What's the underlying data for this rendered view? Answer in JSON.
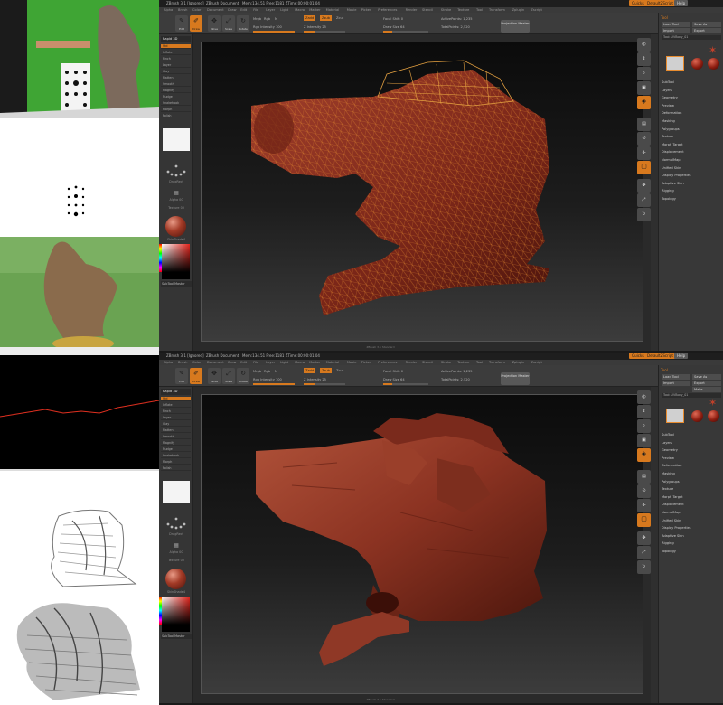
{
  "colors": {
    "orange": "#d7791e",
    "panel": "#383838",
    "mesh": "#8a2a1a",
    "wire": "#e39a2a"
  },
  "left_column": {
    "images": [
      {
        "name": "photo-person-with-statue"
      },
      {
        "name": "calibration-pattern"
      },
      {
        "name": "photo-bronze-statue"
      },
      {
        "name": "laser-scan-line"
      },
      {
        "name": "point-cloud-statue"
      },
      {
        "name": "point-cloud-statue-closeup"
      }
    ]
  },
  "windows": [
    {
      "id": "top",
      "title_main": "ZBrush 3.1 [Ignored]",
      "title_doc": "ZBrush Document",
      "title_stats": "Mem:134.51 Free:1181 ZTime:00:00:01.04",
      "quicksave": "Quicksave",
      "btn_help": "Help",
      "btn_defaultui": "DefaultZScript",
      "menus": [
        "Alpha",
        "Brush",
        "Color",
        "Document",
        "Draw",
        "Edit",
        "File",
        "Layer",
        "Light",
        "Macro",
        "Marker",
        "Material",
        "Movie",
        "Picker",
        "Preferences",
        "Render",
        "Stencil",
        "Stroke",
        "Texture",
        "Tool",
        "Transform",
        "Zplugin",
        "Zscript"
      ],
      "shelf": {
        "edit": "Edit",
        "draw": "Draw",
        "move": "Move",
        "scale": "Scale",
        "rotate": "Rotate",
        "mrgb": "Mrgb",
        "rgb": "Rgb",
        "m": "M",
        "zadd": "Zadd",
        "zsub": "Zsub",
        "zcut": "Zcut",
        "rgb_intensity": "Rgb Intensity 100",
        "z_intensity": "Z Intensity 25",
        "focal_shift": "Focal Shift 0",
        "draw_size": "Draw Size 64",
        "active_points": "ActivePoints: 1,235",
        "total_points": "TotalPoints: 2,520",
        "projection_master": "Projection Master"
      },
      "left_palette": {
        "rapid": "Rapid 3D",
        "items": [
          "Std",
          "Inflate",
          "Pinch",
          "Layer",
          "Clay",
          "Flatten",
          "Smooth",
          "Magnify",
          "Nudge",
          "Snakehook",
          "Morph",
          "Polish"
        ],
        "selected_index": 0,
        "stroke_label": "DragRect",
        "alpha_label": "Alpha 00",
        "texture_label": "Texture 00",
        "material_label": "SkinShade4",
        "subtool_label": "SubTool Master"
      },
      "right_panel": {
        "tool_header": "Tool",
        "load": "Load Tool",
        "save": "Save As",
        "import": "Import",
        "export": "Export",
        "make_poly": "Make PolyMesh3D",
        "tool_name": "Tool: UVBody_01",
        "menu_items": [
          "SubTool",
          "Layers",
          "Geometry",
          "Preview",
          "Deformation",
          "Masking",
          "Polygroups",
          "Texture",
          "Morph Target",
          "Displacement",
          "NormalMap",
          "Unified Skin",
          "Display Properties",
          "Adaptive Skin",
          "Rigging",
          "Topology"
        ],
        "show_make_poly": false
      },
      "viewport_caption": "ZBrush 3.1 Standard",
      "mesh_wire": true
    },
    {
      "id": "bottom",
      "title_main": "ZBrush 3.1 [Ignored]",
      "title_doc": "ZBrush Document",
      "title_stats": "Mem:134.51 Free:1181 ZTime:00:00:01.04",
      "quicksave": "Quicksave",
      "btn_help": "Help",
      "btn_defaultui": "DefaultZScript",
      "menus": [
        "Alpha",
        "Brush",
        "Color",
        "Document",
        "Draw",
        "Edit",
        "File",
        "Layer",
        "Light",
        "Macro",
        "Marker",
        "Material",
        "Movie",
        "Picker",
        "Preferences",
        "Render",
        "Stencil",
        "Stroke",
        "Texture",
        "Tool",
        "Transform",
        "Zplugin",
        "Zscript"
      ],
      "shelf": {
        "edit": "Edit",
        "draw": "Draw",
        "move": "Move",
        "scale": "Scale",
        "rotate": "Rotate",
        "mrgb": "Mrgb",
        "rgb": "Rgb",
        "m": "M",
        "zadd": "Zadd",
        "zsub": "Zsub",
        "zcut": "Zcut",
        "rgb_intensity": "Rgb Intensity 100",
        "z_intensity": "Z Intensity 25",
        "focal_shift": "Focal Shift 0",
        "draw_size": "Draw Size 64",
        "active_points": "ActivePoints: 1,235",
        "total_points": "TotalPoints: 2,520",
        "projection_master": "Projection Master"
      },
      "left_palette": {
        "rapid": "Rapid 3D",
        "items": [
          "Std",
          "Inflate",
          "Pinch",
          "Layer",
          "Clay",
          "Flatten",
          "Smooth",
          "Magnify",
          "Nudge",
          "Snakehook",
          "Morph",
          "Polish"
        ],
        "selected_index": 0,
        "stroke_label": "DragRect",
        "alpha_label": "Alpha 00",
        "texture_label": "Texture 00",
        "material_label": "SkinShade4",
        "subtool_label": "SubTool Master"
      },
      "right_panel": {
        "tool_header": "Tool",
        "load": "Load Tool",
        "save": "Save As",
        "import": "Import",
        "export": "Export",
        "make_poly": "Make PolyMesh3D",
        "tool_name": "Tool: UVBody_01",
        "menu_items": [
          "SubTool",
          "Layers",
          "Geometry",
          "Preview",
          "Deformation",
          "Masking",
          "Polygroups",
          "Texture",
          "Morph Target",
          "Displacement",
          "NormalMap",
          "Unified Skin",
          "Display Properties",
          "Adaptive Skin",
          "Rigging",
          "Topology"
        ],
        "show_make_poly": true
      },
      "viewport_caption": "ZBrush 3.1 Standard",
      "mesh_wire": false
    }
  ]
}
